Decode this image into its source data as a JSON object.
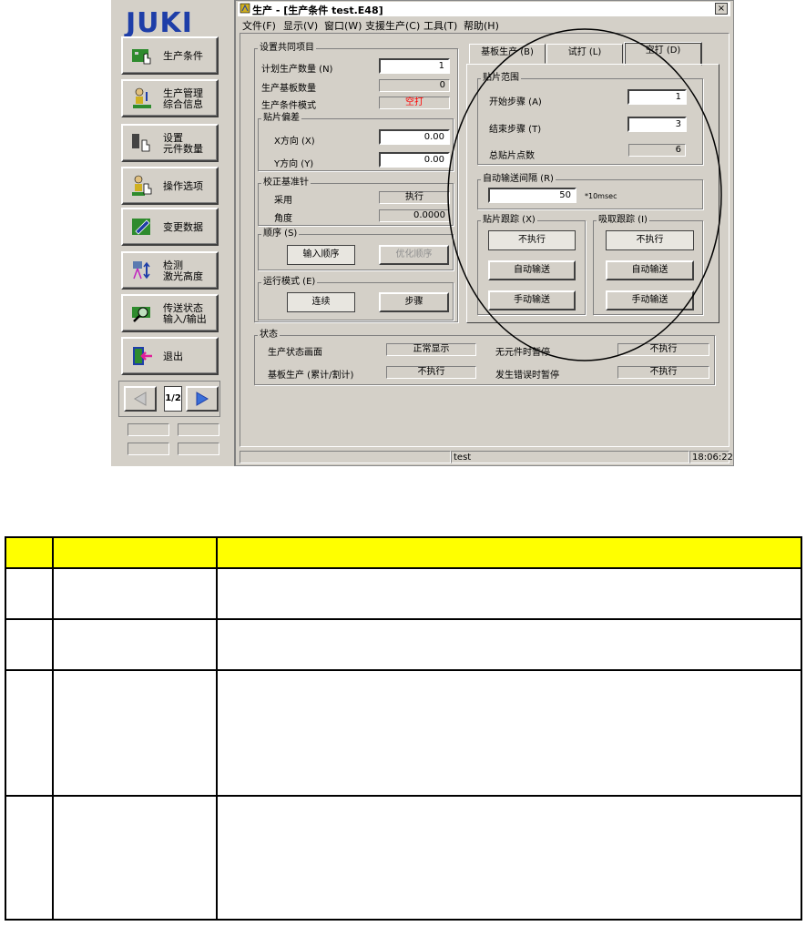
{
  "sidebar": {
    "logo": "JUKI",
    "buttons": [
      {
        "label": "生产条件",
        "label2": ""
      },
      {
        "label": "生产管理",
        "label2": "综合信息"
      },
      {
        "label": "设置",
        "label2": "元件数量"
      },
      {
        "label": "操作选项",
        "label2": ""
      },
      {
        "label": "变更数据",
        "label2": ""
      },
      {
        "label": "检测",
        "label2": "激光高度"
      },
      {
        "label": "传送状态",
        "label2": "输入/输出"
      },
      {
        "label": "退出",
        "label2": ""
      }
    ],
    "page_indicator": "1/2"
  },
  "window": {
    "title": "生产 - [生产条件 test.E48]",
    "close": "×",
    "menu": [
      "文件(F)",
      "显示(V)",
      "窗口(W)",
      "支援生产(C)",
      "工具(T)",
      "帮助(H)"
    ]
  },
  "common": {
    "group_title": "设置共同项目",
    "plan_qty_label": "计划生产数量 (N)",
    "plan_qty_value": "1",
    "board_qty_label": "生产基板数量",
    "board_qty_value": "0",
    "mode_label": "生产条件模式",
    "mode_value": "空打",
    "offset_title": "贴片偏差",
    "x_label": "X方向 (X)",
    "x_value": "0.00",
    "y_label": "Y方向 (Y)",
    "y_value": "0.00",
    "fid_title": "校正基准针",
    "fid_use_label": "采用",
    "fid_use_value": "执行",
    "fid_angle_label": "角度",
    "fid_angle_value": "0.0000",
    "order_title": "顺序 (S)",
    "order_input": "输入顺序",
    "order_opt": "优化顺序",
    "run_title": "运行模式 (E)",
    "run_cont": "连续",
    "run_step": "步骤"
  },
  "tabs": [
    "基板生产 (B)",
    "试打 (L)",
    "空打 (D)"
  ],
  "range": {
    "title": "贴片范围",
    "start_label": "开始步骤 (A)",
    "start_value": "1",
    "end_label": "结束步骤 (T)",
    "end_value": "3",
    "total_label": "总贴片点数",
    "total_value": "6"
  },
  "auto_feed": {
    "title": "自动输送间隔 (R)",
    "value": "50",
    "unit": "*10msec"
  },
  "place_track": {
    "title": "贴片跟踪 (X)",
    "state": "不执行",
    "auto": "自动输送",
    "manual": "手动输送"
  },
  "pick_track": {
    "title": "吸取跟踪 (I)",
    "state": "不执行",
    "auto": "自动输送",
    "manual": "手动输送"
  },
  "status": {
    "title": "状态",
    "prod_screen_label": "生产状态画面",
    "prod_screen_value": "正常显示",
    "no_part_label": "无元件时暂停",
    "no_part_value": "不执行",
    "board_prod_label": "基板生产 (累计/割计)",
    "board_prod_value": "不执行",
    "error_label": "发生错误时暂停",
    "error_value": "不执行"
  },
  "statusbar": {
    "file": "test",
    "time": "18:06:22"
  },
  "colors": {
    "panel": "#d4d0c8",
    "logo": "#1e3ea8",
    "warn_text": "#ff0000",
    "table_header": "#ffff00"
  }
}
